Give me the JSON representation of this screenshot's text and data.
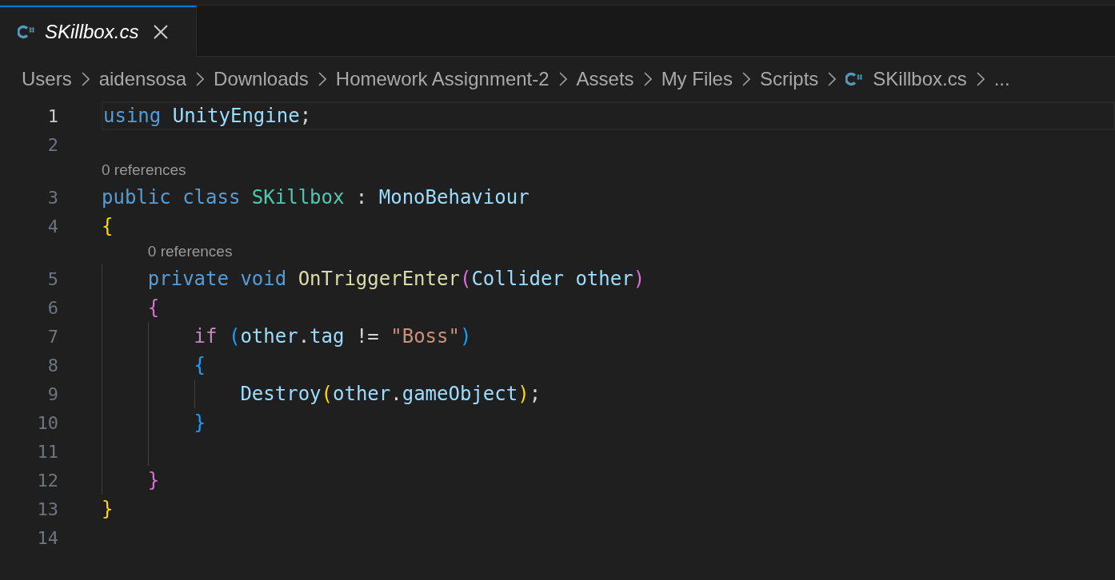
{
  "tabs": [
    {
      "label": "SKillbox.cs",
      "selected": true
    }
  ],
  "breadcrumb": [
    {
      "label": "Users",
      "kind": "folder"
    },
    {
      "label": "aidensosa",
      "kind": "folder"
    },
    {
      "label": "Downloads",
      "kind": "folder"
    },
    {
      "label": "Homework Assignment-2",
      "kind": "folder"
    },
    {
      "label": "Assets",
      "kind": "folder"
    },
    {
      "label": "My Files",
      "kind": "folder"
    },
    {
      "label": "Scripts",
      "kind": "folder"
    },
    {
      "label": "SKillbox.cs",
      "kind": "file"
    },
    {
      "label": "...",
      "kind": "more"
    }
  ],
  "lines": [
    {
      "number": "1",
      "current": true,
      "tokens": [
        {
          "text": "using",
          "kind": "keyword"
        },
        {
          "text": "UnityEngine",
          "kind": "namespace",
          "space_before": true
        },
        {
          "text": ";",
          "kind": "punct"
        }
      ]
    },
    {
      "number": "2",
      "current": false
    },
    {
      "number": "3",
      "current": false,
      "codelens": "0 references",
      "tokens": [
        {
          "text": "public",
          "kind": "keyword"
        },
        {
          "text": "class",
          "kind": "keyword",
          "space_before": true
        },
        {
          "text": "SKillbox",
          "kind": "type",
          "space_before": true
        },
        {
          "text": ":",
          "kind": "punct",
          "space_before": true
        },
        {
          "text": "MonoBehaviour",
          "kind": "namespace",
          "space_before": true
        }
      ]
    },
    {
      "number": "4",
      "current": false,
      "tokens": [
        {
          "text": "{",
          "kind": "bracket1"
        }
      ],
      "children": [
        {
          "number": "5",
          "current": false,
          "codelens": "0 references",
          "tokens": [
            {
              "text": "private",
              "kind": "keyword"
            },
            {
              "text": "void",
              "kind": "keyword",
              "space_before": true
            },
            {
              "text": "OnTriggerEnter",
              "kind": "method",
              "space_before": true
            },
            {
              "text": "(",
              "kind": "bracket2"
            },
            {
              "text": "Collider",
              "kind": "namespace"
            },
            {
              "text": "other",
              "kind": "variable",
              "space_before": true
            },
            {
              "text": ")",
              "kind": "bracket2"
            }
          ]
        },
        {
          "number": "6",
          "current": false,
          "tokens": [
            {
              "text": "{",
              "kind": "bracket2"
            }
          ],
          "children": [
            {
              "number": "7",
              "current": false,
              "tokens": [
                {
                  "text": "if",
                  "kind": "control"
                },
                {
                  "text": "(",
                  "kind": "bracket3",
                  "space_before": true
                },
                {
                  "text": "other",
                  "kind": "variable"
                },
                {
                  "text": ".",
                  "kind": "punct"
                },
                {
                  "text": "tag",
                  "kind": "variable"
                },
                {
                  "text": "!=",
                  "kind": "punct",
                  "space_before": true
                },
                {
                  "text": "\"Boss\"",
                  "kind": "string",
                  "space_before": true
                },
                {
                  "text": ")",
                  "kind": "bracket3"
                }
              ]
            },
            {
              "number": "8",
              "current": false,
              "tokens": [
                {
                  "text": "{",
                  "kind": "bracket3"
                }
              ],
              "children": [
                {
                  "number": "9",
                  "current": false,
                  "tokens": [
                    {
                      "text": "Destroy",
                      "kind": "namespace"
                    },
                    {
                      "text": "(",
                      "kind": "bracket1"
                    },
                    {
                      "text": "other",
                      "kind": "variable"
                    },
                    {
                      "text": ".",
                      "kind": "punct"
                    },
                    {
                      "text": "gameObject",
                      "kind": "variable"
                    },
                    {
                      "text": ")",
                      "kind": "bracket1"
                    },
                    {
                      "text": ";",
                      "kind": "punct"
                    }
                  ]
                }
              ]
            },
            {
              "number": "10",
              "current": false,
              "tokens": [
                {
                  "text": "}",
                  "kind": "bracket3"
                }
              ]
            },
            {
              "number": "11",
              "current": false
            }
          ]
        },
        {
          "number": "12",
          "current": false,
          "tokens": [
            {
              "text": "}",
              "kind": "bracket2"
            }
          ]
        }
      ]
    },
    {
      "number": "13",
      "current": false,
      "tokens": [
        {
          "text": "}",
          "kind": "bracket1"
        }
      ]
    },
    {
      "number": "14",
      "current": false
    }
  ]
}
